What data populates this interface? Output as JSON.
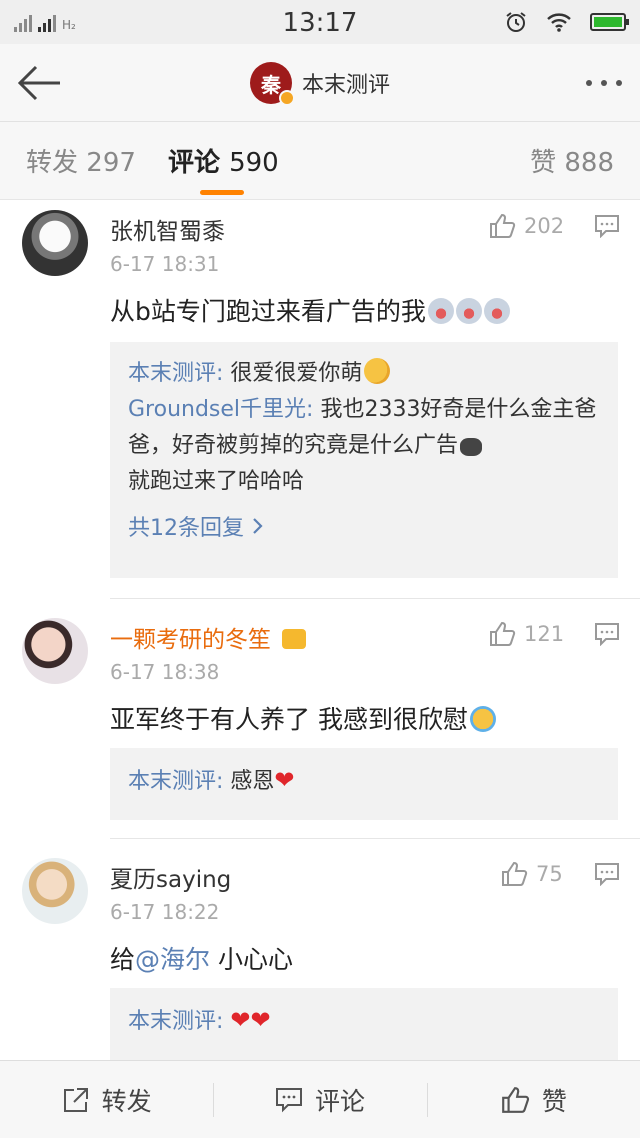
{
  "status_bar": {
    "carrier_left": "X",
    "network_label": "H₂",
    "time": "13:17"
  },
  "nav": {
    "logo_char": "秦",
    "title": "本末测评"
  },
  "tabs": {
    "repost": {
      "label": "转发",
      "count": "297"
    },
    "comment": {
      "label": "评论",
      "count": "590"
    },
    "like": {
      "label": "赞",
      "count": "888"
    }
  },
  "comments": [
    {
      "name": "张机智蜀黍",
      "time": "6-17 18:31",
      "likes": "202",
      "text": "从b站专门跑过来看广告的我",
      "replies": [
        {
          "author": "本末测评:",
          "text": " 很爱很爱你萌"
        },
        {
          "author": "Groundsel千里光:",
          "text": " 我也2333好奇是什么金主爸爸，好奇被剪掉的究竟是什么广告",
          "text_line3": "就跑过来了哈哈哈"
        }
      ],
      "more_replies": "共12条回复"
    },
    {
      "name": "一颗考研的冬笙",
      "time": "6-17 18:38",
      "likes": "121",
      "text": "亚军终于有人养了 我感到很欣慰",
      "replies": [
        {
          "author": "本末测评:",
          "text": " 感恩"
        }
      ]
    },
    {
      "name": "夏历saying",
      "time": "6-17 18:22",
      "likes": "75",
      "text_prefix": "给",
      "mention": "@海尔",
      "text_suffix": " 小心心",
      "replies": [
        {
          "author": "本末测评:",
          "text": " "
        }
      ]
    }
  ],
  "bottom_bar": {
    "repost": "转发",
    "comment": "评论",
    "like": "赞"
  },
  "colors": {
    "accent": "#ff8200",
    "link": "#5b80b4",
    "vip_name": "#e96c0e"
  }
}
